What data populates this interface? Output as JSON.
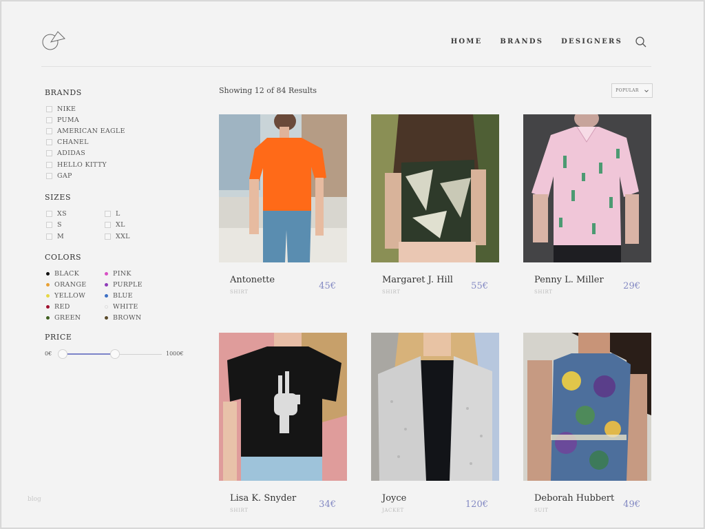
{
  "nav": {
    "items": [
      "HOME",
      "BRANDS",
      "DESIGNERS"
    ],
    "search_icon": "search-icon"
  },
  "sidebar": {
    "brands_title": "BRANDS",
    "brands": [
      "NIKE",
      "PUMA",
      "AMERICAN EAGLE",
      "CHANEL",
      "ADIDAS",
      "HELLO KITTY",
      "GAP"
    ],
    "sizes_title": "SIZES",
    "sizes": [
      "XS",
      "L",
      "S",
      "XL",
      "M",
      "XXL"
    ],
    "colors_title": "COLORS",
    "colors": [
      {
        "name": "BLACK",
        "hex": "#111111"
      },
      {
        "name": "PINK",
        "hex": "#d84fc4"
      },
      {
        "name": "ORANGE",
        "hex": "#e8a034"
      },
      {
        "name": "PURPLE",
        "hex": "#8e3bb8"
      },
      {
        "name": "YELLOW",
        "hex": "#e6d744"
      },
      {
        "name": "BLUE",
        "hex": "#3c6fc4"
      },
      {
        "name": "RED",
        "hex": "#a0102e"
      },
      {
        "name": "WHITE",
        "hex": "#f4f4f4"
      },
      {
        "name": "GREEN",
        "hex": "#3f5f1f"
      },
      {
        "name": "BROWN",
        "hex": "#5a4a2a"
      }
    ],
    "price_title": "PRICE",
    "price_min": "0€",
    "price_max": "1000€"
  },
  "results": {
    "text": "Showing 12 of 84 Results",
    "sort_label": "POPULAR"
  },
  "products": [
    {
      "name": "Antonette",
      "category": "SHIRT",
      "price": "45€"
    },
    {
      "name": "Margaret J. Hill",
      "category": "SHIRT",
      "price": "55€"
    },
    {
      "name": "Penny L. Miller",
      "category": "SHIRT",
      "price": "29€"
    },
    {
      "name": "Lisa K. Snyder",
      "category": "SHIRT",
      "price": "34€"
    },
    {
      "name": "Joyce",
      "category": "JACKET",
      "price": "120€"
    },
    {
      "name": "Deborah Hubbert",
      "category": "SUIT",
      "price": "49€"
    }
  ],
  "footer": {
    "blog": "blog"
  },
  "accent": "#8389c3"
}
